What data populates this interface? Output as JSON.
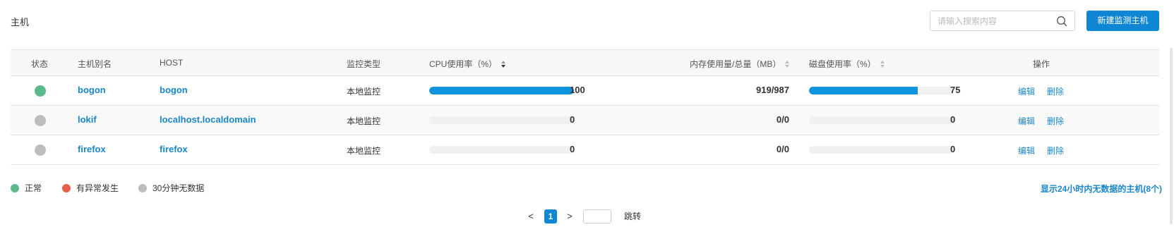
{
  "header": {
    "title": "主机",
    "search_placeholder": "请输入搜索内容",
    "new_button": "新建监测主机"
  },
  "table": {
    "columns": {
      "status": "状态",
      "alias": "主机别名",
      "host": "HOST",
      "type": "监控类型",
      "cpu": "CPU使用率（%）",
      "memory": "内存使用量/总量（MB）",
      "disk": "磁盘使用率（%）",
      "actions": "操作"
    },
    "rows": [
      {
        "status": "正常",
        "status_color": "#5bb98c",
        "alias": "bogon",
        "host": "bogon",
        "type": "本地监控",
        "cpu": "100",
        "cpu_pct": 100,
        "memory": "919/987",
        "disk": "75",
        "disk_pct": 75,
        "edit": "编辑",
        "delete": "删除"
      },
      {
        "status": "30分钟无数据",
        "status_color": "#bdbdbd",
        "alias": "lokif",
        "host": "localhost.localdomain",
        "type": "本地监控",
        "cpu": "0",
        "cpu_pct": 0,
        "memory": "0/0",
        "disk": "0",
        "disk_pct": 0,
        "edit": "编辑",
        "delete": "删除"
      },
      {
        "status": "30分钟无数据",
        "status_color": "#bdbdbd",
        "alias": "firefox",
        "host": "firefox",
        "type": "本地监控",
        "cpu": "0",
        "cpu_pct": 0,
        "memory": "0/0",
        "disk": "0",
        "disk_pct": 0,
        "edit": "编辑",
        "delete": "删除"
      }
    ]
  },
  "legend": {
    "normal": {
      "label": "正常",
      "color": "#5bb98c"
    },
    "abnormal": {
      "label": "有异常发生",
      "color": "#e8604a"
    },
    "nodata": {
      "label": "30分钟无数据",
      "color": "#bdbdbd"
    },
    "show_link": "显示24小时内无数据的主机(8个)"
  },
  "pagination": {
    "prev": "<",
    "current": "1",
    "next": ">",
    "jump": "跳转"
  },
  "colors": {
    "accent": "#0e86d4",
    "bar": "#0e93dc",
    "link": "#1a86c9"
  }
}
